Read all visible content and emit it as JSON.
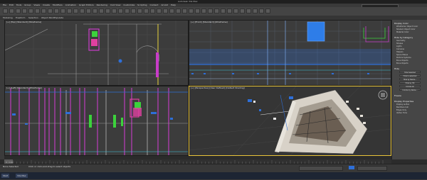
{
  "app": {
    "title": "Autodesk 3ds Max"
  },
  "menus": [
    "File",
    "Edit",
    "Tools",
    "Group",
    "Views",
    "Create",
    "Modifiers",
    "Animation",
    "Graph Editors",
    "Rendering",
    "Civil View",
    "Customize",
    "Scripting",
    "Content",
    "Arnold",
    "Help"
  ],
  "ribbon": {
    "tabs": [
      "Modeling",
      "Freeform",
      "Selection",
      "Object Paint",
      "Populate"
    ]
  },
  "viewports": {
    "top_left": {
      "label": "[+] [Top] [Standard] [Wireframe]"
    },
    "top_right": {
      "label": "[+] [Front] [Standard] [Wireframe]"
    },
    "bottom_left": {
      "label": "[+] [Left] [Standard] [Wireframe]"
    },
    "bottom_right": {
      "label": "[+] [Perspective] [User Defined] [Default Shading]"
    }
  },
  "command_panel": {
    "sections": [
      {
        "title": "Display Color",
        "items": [
          "Wireframe: Object Color",
          "Shaded: Object Color",
          "Material Color"
        ]
      },
      {
        "title": "Hide by Category",
        "items": [
          "Geometry",
          "Shapes",
          "Lights",
          "Cameras",
          "Helpers",
          "Space Warps",
          "Particle Systems",
          "Bone Objects",
          "Bone Objects"
        ]
      },
      {
        "title": "Hide",
        "items": []
      },
      {
        "title": "Freeze",
        "items": []
      },
      {
        "title": "Display Properties",
        "items": [
          "Display as Box",
          "Backface Cull",
          "Edges Only",
          "Vertex Ticks"
        ]
      }
    ],
    "buttons": [
      "Hide Selected",
      "Hide Unselected",
      "Hide by Name...",
      "Hide by Hit",
      "Unhide All",
      "Unhide by Name..."
    ]
  },
  "status": {
    "selection": "None Selected",
    "frame": "0 / 100",
    "hint": "Click or click-and-drag to select objects"
  },
  "taskbar": {
    "items": [
      "Start",
      "3ds Max"
    ]
  },
  "colors": {
    "accent": "#e8c43a",
    "wire_magenta": "#c83cc8",
    "wire_blue": "#2e6fd8",
    "wire_green": "#3cd23c",
    "wire_cyan": "#3cc8e0"
  }
}
